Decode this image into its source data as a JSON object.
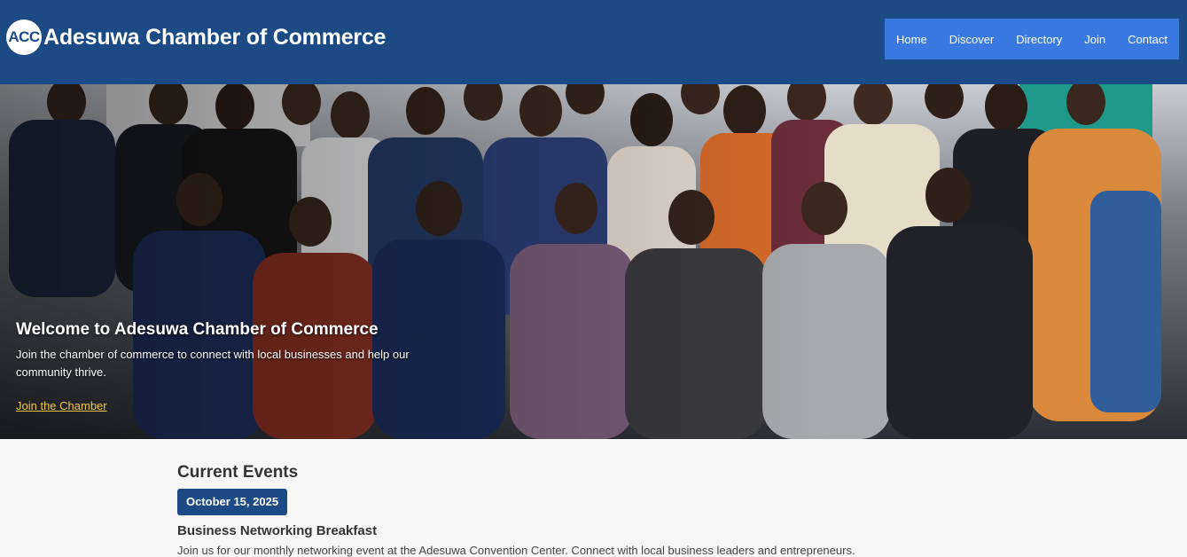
{
  "header": {
    "logo_text": "ACC",
    "site_title": "Adesuwa Chamber of Commerce"
  },
  "nav": {
    "items": [
      "Home",
      "Discover",
      "Directory",
      "Join",
      "Contact"
    ]
  },
  "hero": {
    "title": "Welcome to Adesuwa Chamber of Commerce",
    "text": "Join the chamber of commerce to connect with local businesses and help our community thrive.",
    "link_label": "Join the Chamber"
  },
  "events": {
    "heading": "Current Events",
    "items": [
      {
        "date": "October 15, 2025",
        "title": "Business Networking Breakfast",
        "description": "Join us for our monthly networking event at the Adesuwa Convention Center. Connect with local business leaders and entrepreneurs."
      }
    ]
  },
  "colors": {
    "header_bg": "#1c4a85",
    "nav_bg": "#3a7ae0",
    "link_accent": "#f5c842",
    "page_bg": "#f6f6f6"
  }
}
